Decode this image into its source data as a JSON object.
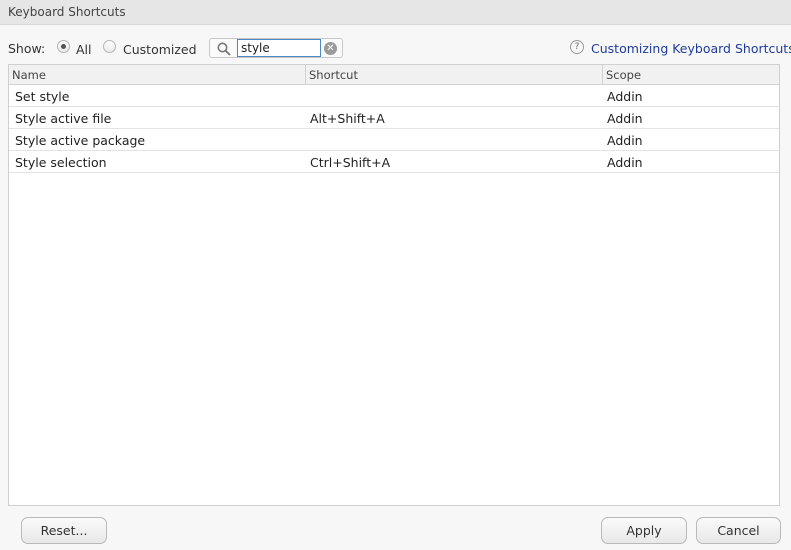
{
  "window": {
    "title": "Keyboard Shortcuts"
  },
  "filter": {
    "show_label": "Show:",
    "options": [
      {
        "label": "All",
        "checked": true
      },
      {
        "label": "Customized",
        "checked": false
      }
    ]
  },
  "search": {
    "value": "style",
    "icon": "search-icon",
    "clear_icon": "clear-icon"
  },
  "help": {
    "icon_glyph": "?",
    "link": "Customizing Keyboard Shortcuts"
  },
  "table": {
    "columns": [
      "Name",
      "Shortcut",
      "Scope"
    ],
    "rows": [
      {
        "name": "Set style",
        "shortcut": "",
        "scope": "Addin"
      },
      {
        "name": "Style active file",
        "shortcut": "Alt+Shift+A",
        "scope": "Addin"
      },
      {
        "name": "Style active package",
        "shortcut": "",
        "scope": "Addin"
      },
      {
        "name": "Style selection",
        "shortcut": "Ctrl+Shift+A",
        "scope": "Addin"
      }
    ]
  },
  "buttons": {
    "reset": "Reset...",
    "apply": "Apply",
    "cancel": "Cancel"
  }
}
